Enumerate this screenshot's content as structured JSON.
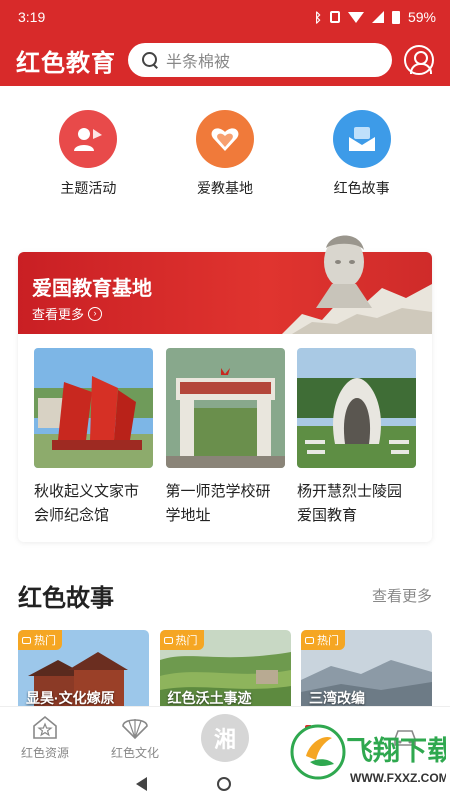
{
  "status_bar": {
    "time": "3:19",
    "battery": "59%"
  },
  "header": {
    "title": "红色教育",
    "search_placeholder": "半条棉被"
  },
  "quick_menu": [
    {
      "label": "主题活动",
      "icon": "people-flag-icon",
      "color": "#e84a4a"
    },
    {
      "label": "爱教基地",
      "icon": "heart-icon",
      "color": "#f07a3a"
    },
    {
      "label": "红色故事",
      "icon": "mail-icon",
      "color": "#3d9be8"
    }
  ],
  "base_section": {
    "title": "爱国教育基地",
    "more": "查看更多",
    "items": [
      {
        "name": "秋收起义文家市会师纪念馆"
      },
      {
        "name": "第一师范学校研学地址"
      },
      {
        "name": "杨开慧烈士陵园爱国教育"
      }
    ]
  },
  "story_section": {
    "title": "红色故事",
    "more": "查看更多",
    "tag": "热门",
    "cards": [
      {
        "caption": "显昊·文化嫁原"
      },
      {
        "caption": "红色沃土事迹"
      },
      {
        "caption": "三湾改编"
      }
    ]
  },
  "bottom_nav": {
    "items": [
      {
        "label": "红色资源",
        "icon": "star-house-icon"
      },
      {
        "label": "红色文化",
        "icon": "fan-icon"
      },
      {
        "label": "湘",
        "icon": "center-logo"
      },
      {
        "label": "",
        "icon": "bookmark-icon"
      },
      {
        "label": "",
        "icon": "car-icon"
      }
    ]
  },
  "watermark": {
    "text": "飞翔下载",
    "url": "WWW.FXXZ.COM"
  },
  "colors": {
    "brand_red": "#d82a2a",
    "hot_tag": "#f5a623"
  }
}
